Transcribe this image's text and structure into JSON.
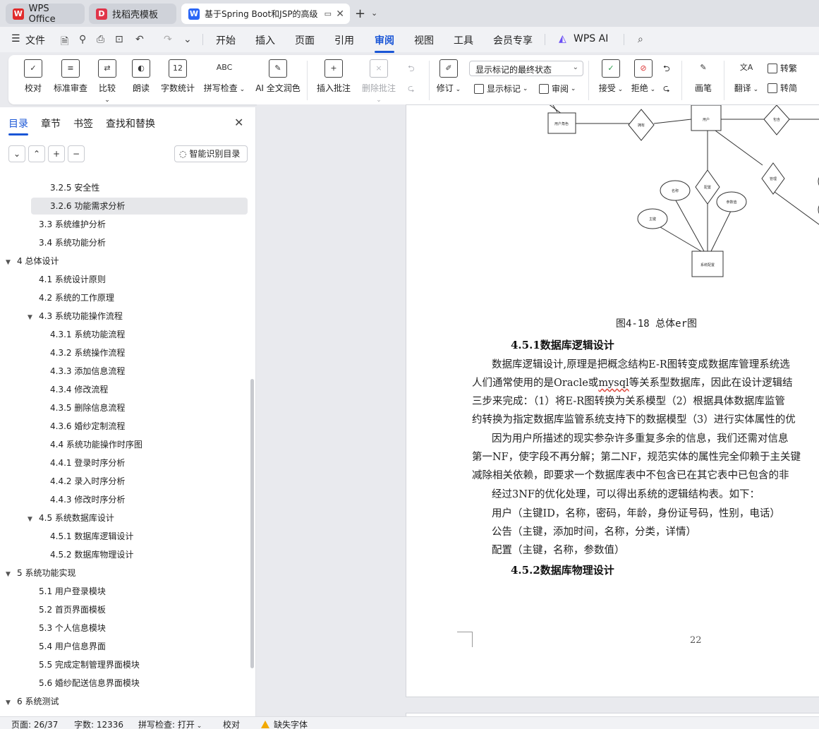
{
  "tabs": [
    {
      "label": "WPS Office",
      "icon": "wps-icon",
      "color": "#e02b2b"
    },
    {
      "label": "找稻壳模板",
      "icon": "docer-icon",
      "color": "#e0354a"
    },
    {
      "label": "基于Spring Boot和JSP的高级",
      "icon": "word-doc-icon",
      "color": "#2b66f6"
    }
  ],
  "menu": {
    "file": "文件",
    "items": [
      "开始",
      "插入",
      "页面",
      "引用",
      "审阅",
      "视图",
      "工具",
      "会员专享"
    ],
    "active": "审阅",
    "wps_ai": "WPS AI"
  },
  "ribbon": {
    "proofread": "校对",
    "standard_review": "标准审查",
    "compare": "比较",
    "read_aloud": "朗读",
    "word_count": "字数统计",
    "spell_check": "拼写检查",
    "ai_polish": "AI 全文润色",
    "insert_comment": "插入批注",
    "delete_comment": "删除批注",
    "track_changes": "修订",
    "show_markup": "显示标记",
    "review": "审阅",
    "markup_mode": "显示标记的最终状态",
    "accept": "接受",
    "reject": "拒绝",
    "ink": "画笔",
    "translate": "翻译",
    "to_traditional": "转繁",
    "to_simplified": "转简",
    "glyph_word_count": "12",
    "glyph_spell": "ABC"
  },
  "sidebar": {
    "tabs": [
      "目录",
      "章节",
      "书签",
      "查找和替换"
    ],
    "smart_toc": "智能识别目录",
    "toc": [
      {
        "text": "3.2.5  安全性",
        "level": 3,
        "expand": ""
      },
      {
        "text": "3.2.6  功能需求分析",
        "level": 3,
        "expand": "",
        "selected": true
      },
      {
        "text": "3.3  系统维护分析",
        "level": 2,
        "expand": ""
      },
      {
        "text": "3.4  系统功能分析",
        "level": 2,
        "expand": ""
      },
      {
        "text": "4  总体设计",
        "level": 1,
        "expand": "▼"
      },
      {
        "text": "4.1 系统设计原则",
        "level": 2,
        "expand": ""
      },
      {
        "text": "4.2 系统的工作原理",
        "level": 2,
        "expand": ""
      },
      {
        "text": "4.3 系统功能操作流程",
        "level": 2,
        "expand": "▼"
      },
      {
        "text": "4.3.1 系统功能流程",
        "level": 3,
        "expand": ""
      },
      {
        "text": "4.3.2 系统操作流程",
        "level": 3,
        "expand": ""
      },
      {
        "text": "4.3.3 添加信息流程",
        "level": 3,
        "expand": ""
      },
      {
        "text": "4.3.4 修改流程",
        "level": 3,
        "expand": ""
      },
      {
        "text": "4.3.5 删除信息流程",
        "level": 3,
        "expand": ""
      },
      {
        "text": "4.3.6 婚纱定制流程",
        "level": 3,
        "expand": ""
      },
      {
        "text": "4.4 系统功能操作时序图",
        "level": 3,
        "expand": ""
      },
      {
        "text": "4.4.1 登录时序分析",
        "level": 3,
        "expand": ""
      },
      {
        "text": "4.4.2 录入时序分析",
        "level": 3,
        "expand": ""
      },
      {
        "text": "4.4.3 修改时序分析",
        "level": 3,
        "expand": ""
      },
      {
        "text": "4.5 系统数据库设计",
        "level": 2,
        "expand": "▼"
      },
      {
        "text": "4.5.1 数据库逻辑设计",
        "level": 3,
        "expand": ""
      },
      {
        "text": "4.5.2 数据库物理设计",
        "level": 3,
        "expand": ""
      },
      {
        "text": "5  系统功能实现",
        "level": 1,
        "expand": "▼"
      },
      {
        "text": "5.1  用户登录模块",
        "level": 2,
        "expand": ""
      },
      {
        "text": "5.2  首页界面模板",
        "level": 2,
        "expand": ""
      },
      {
        "text": "5.3  个人信息模块",
        "level": 2,
        "expand": ""
      },
      {
        "text": "5.4  用户信息界面",
        "level": 2,
        "expand": ""
      },
      {
        "text": "5.5  完成定制管理界面模块",
        "level": 2,
        "expand": ""
      },
      {
        "text": "5.6  婚纱配送信息界面模块",
        "level": 2,
        "expand": ""
      },
      {
        "text": "6 系统测试",
        "level": 1,
        "expand": "▼"
      }
    ]
  },
  "diagram": {
    "entities": [
      "用户角色",
      "用户",
      "系统配置"
    ],
    "relations": [
      "拥有",
      "包含",
      "配置",
      "管理"
    ],
    "attributes": [
      "名称",
      "参数值",
      "主键"
    ]
  },
  "document": {
    "caption": "图4-18 总体er图",
    "heading1": "4.5.1数据库逻辑设计",
    "paragraph_lines": [
      "数据库逻辑设计,原理是把概念结构E-R图转变成数据库管理系统选",
      "人们通常使用的是Oracle或mysql等关系型数据库，因此在设计逻辑结",
      "三步来完成：（1）将E-R图转换为关系模型（2）根据具体数据库监管",
      "约转换为指定数据库监管系统支持下的数据模型（3）进行实体属性的优",
      "因为用户所描述的现实参杂许多重复多余的信息，我们还需对信息",
      "第一NF，使字段不再分解；第二NF，规范实体的属性完全仰赖于主关键",
      "减除相关依赖，即要求一个数据库表中不包含已在其它表中已包含的非",
      "经过3NF的优化处理，可以得出系统的逻辑结构表。如下：",
      "用户（主键ID，名称，密码，年龄，身份证号码，性别，电话）",
      "公告（主键，添加时间，名称，分类，详情）",
      "配置（主键，名称，参数值）"
    ],
    "heading2": "4.5.2数据库物理设计",
    "page_number": "22"
  },
  "status": {
    "page": "页面: 26/37",
    "words": "字数: 12336",
    "spell": "拼写检查: 打开",
    "proof": "校对",
    "missing_font": "缺失字体"
  },
  "colors": {
    "accent": "#1a56d6",
    "warning": "#f2a900"
  }
}
